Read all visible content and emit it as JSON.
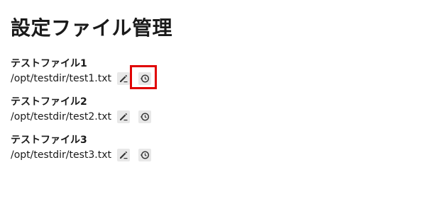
{
  "page": {
    "title": "設定ファイル管理"
  },
  "files": [
    {
      "name": "テストファイル1",
      "path": "/opt/testdir/test1.txt",
      "highlight_history": true
    },
    {
      "name": "テストファイル2",
      "path": "/opt/testdir/test2.txt",
      "highlight_history": false
    },
    {
      "name": "テストファイル3",
      "path": "/opt/testdir/test3.txt",
      "highlight_history": false
    }
  ],
  "icons": {
    "edit": "pencil-edit-icon",
    "history": "history-icon"
  },
  "colors": {
    "icon_bg": "#e8e8e8",
    "icon_fg": "#333333",
    "highlight": "#e00000"
  }
}
